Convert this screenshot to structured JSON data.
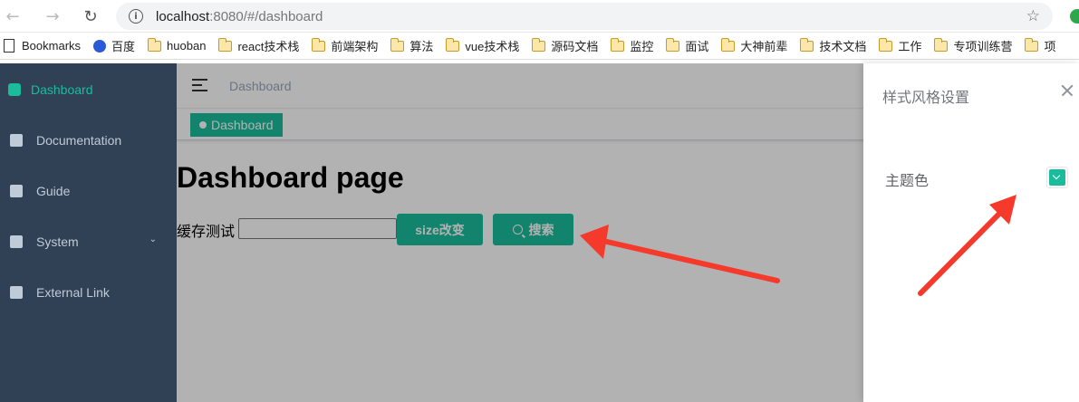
{
  "browser": {
    "url_host": "localhost",
    "url_rest": ":8080/#/dashboard",
    "bookmarks": [
      {
        "label": "Bookmarks",
        "icon": "page-icon"
      },
      {
        "label": "百度",
        "icon": "baidu-icon"
      },
      {
        "label": "huoban",
        "icon": "folder-icon"
      },
      {
        "label": "react技术栈",
        "icon": "folder-icon"
      },
      {
        "label": "前端架构",
        "icon": "folder-icon"
      },
      {
        "label": "算法",
        "icon": "folder-icon"
      },
      {
        "label": "vue技术栈",
        "icon": "folder-icon"
      },
      {
        "label": "源码文档",
        "icon": "folder-icon"
      },
      {
        "label": "监控",
        "icon": "folder-icon"
      },
      {
        "label": "面试",
        "icon": "folder-icon"
      },
      {
        "label": "大神前辈",
        "icon": "folder-icon"
      },
      {
        "label": "技术文档",
        "icon": "folder-icon"
      },
      {
        "label": "工作",
        "icon": "folder-icon"
      },
      {
        "label": "专项训练营",
        "icon": "folder-icon"
      },
      {
        "label": "项",
        "icon": "folder-icon"
      }
    ]
  },
  "sidebar": {
    "items": [
      {
        "label": "Dashboard",
        "active": true
      },
      {
        "label": "Documentation"
      },
      {
        "label": "Guide"
      },
      {
        "label": "System",
        "has_submenu": true
      },
      {
        "label": "External Link"
      }
    ]
  },
  "navbar": {
    "breadcrumb": "Dashboard"
  },
  "tags": {
    "active_tag": "Dashboard"
  },
  "main": {
    "title": "Dashboard page",
    "cache_label": "缓存测试",
    "cache_value": "",
    "size_button": "size改变",
    "search_button": "搜索"
  },
  "drawer": {
    "title": "样式风格设置",
    "theme_label": "主题色",
    "theme_color": "#1abc9c"
  },
  "colors": {
    "sidebar_bg": "#304156",
    "accent": "#1abc9c",
    "annotation": "#f5392b"
  }
}
